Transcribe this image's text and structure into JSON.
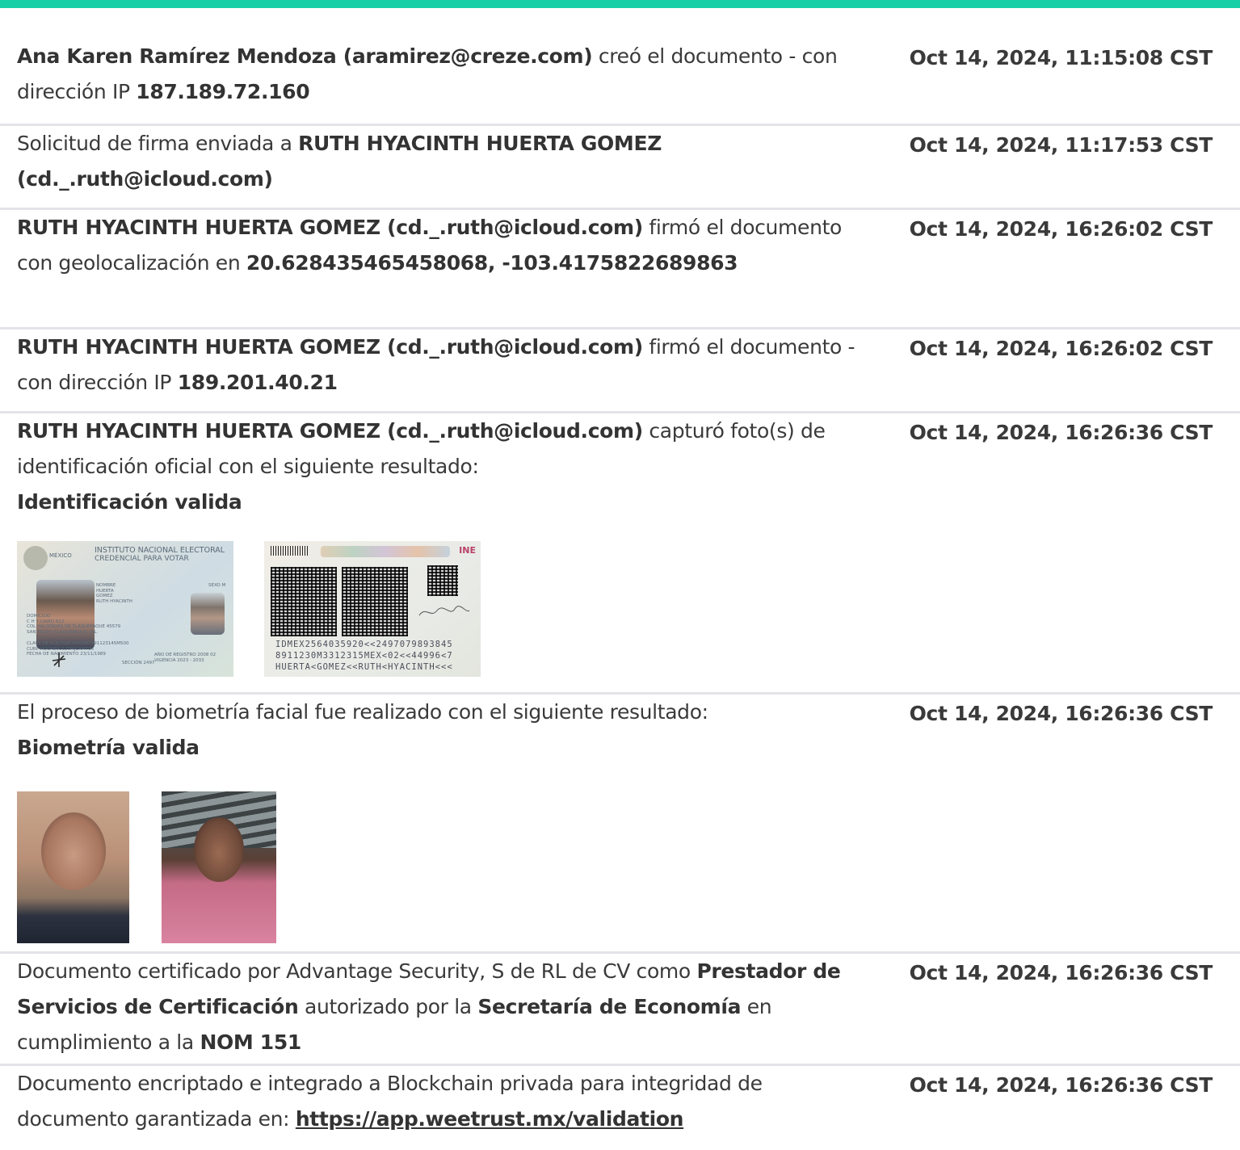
{
  "colors": {
    "accent_bar": "#16cfa6",
    "text": "#3a3a3a",
    "divider": "#e3e3e9"
  },
  "events": [
    {
      "parts": [
        {
          "t": "Ana Karen Ramírez Mendoza (aramirez@creze.com)",
          "b": true
        },
        {
          "t": " creó el documento - con dirección IP ",
          "b": false
        },
        {
          "t": "187.189.72.160",
          "b": true
        }
      ],
      "timestamp": "Oct 14, 2024, 11:15:08 CST"
    },
    {
      "parts": [
        {
          "t": "Solicitud de firma enviada a ",
          "b": false
        },
        {
          "t": "RUTH HYACINTH HUERTA GOMEZ (cd._.ruth@icloud.com)",
          "b": true
        }
      ],
      "timestamp": "Oct 14, 2024, 11:17:53 CST"
    },
    {
      "parts": [
        {
          "t": "RUTH HYACINTH HUERTA GOMEZ (cd._.ruth@icloud.com)",
          "b": true
        },
        {
          "t": " firmó el documento con geolocalización en ",
          "b": false
        },
        {
          "t": "20.628435465458068, -103.4175822689863",
          "b": true
        }
      ],
      "timestamp": "Oct 14, 2024, 16:26:02 CST"
    },
    {
      "parts": [
        {
          "t": "RUTH HYACINTH HUERTA GOMEZ (cd._.ruth@icloud.com)",
          "b": true
        },
        {
          "t": " firmó el documento - con dirección IP ",
          "b": false
        },
        {
          "t": "189.201.40.21",
          "b": true
        }
      ],
      "timestamp": "Oct 14, 2024, 16:26:02 CST"
    },
    {
      "parts": [
        {
          "t": "RUTH HYACINTH HUERTA GOMEZ (cd._.ruth@icloud.com)",
          "b": true
        },
        {
          "t": " capturó foto(s) de identificación oficial con el siguiente resultado:",
          "b": false
        }
      ],
      "result": "Identificación valida",
      "timestamp": "Oct 14, 2024, 16:26:36 CST",
      "id_front": {
        "country": "MÉXICO",
        "institute": "INSTITUTO NACIONAL ELECTORAL",
        "card_type": "CREDENCIAL PARA VOTAR",
        "name_label": "NOMBRE",
        "name_lines": [
          "HUERTA",
          "GOMEZ",
          "RUTH HYACINTH"
        ],
        "sex": "SEXO M",
        "address_label": "DOMICILIO",
        "address_lines": [
          "C H Y CAIRO 612",
          "COL HACIENDAS DE TLAQUEPAQUE 45579",
          "SAN PEDRO TLAQUEPAQUE, JAL."
        ],
        "elector_key": "CLAVE DE ELECTOR  HRGMRT891123145M500",
        "curp": "CURP  HUGR891123MJCRMT03",
        "birth": "FECHA DE NACIMIENTO  23/11/1989",
        "section": "SECCIÓN 2497",
        "registration": "AÑO DE REGISTRO 2008 02",
        "validity": "VIGENCIA 2023 - 2033"
      },
      "id_back": {
        "brand": "INE",
        "mrz": [
          "IDMEX2564035920<<2497079893845",
          "8911230M3312315MEX<02<<44996<7",
          "HUERTA<GOMEZ<<RUTH<HYACINTH<<<"
        ]
      }
    },
    {
      "parts": [
        {
          "t": "El proceso de biometría facial fue realizado con el siguiente resultado:",
          "b": false
        }
      ],
      "result": "Biometría valida",
      "timestamp": "Oct 14, 2024, 16:26:36 CST"
    },
    {
      "parts": [
        {
          "t": "Documento certificado por Advantage Security, S de RL de CV como ",
          "b": false
        },
        {
          "t": "Prestador de Servicios de Certificación",
          "b": true
        },
        {
          "t": " autorizado por la ",
          "b": false
        },
        {
          "t": "Secretaría de Economía",
          "b": true
        },
        {
          "t": " en cumplimiento a la ",
          "b": false
        },
        {
          "t": "NOM 151",
          "b": true
        }
      ],
      "timestamp": "Oct 14, 2024, 16:26:36 CST"
    },
    {
      "parts": [
        {
          "t": "Documento encriptado e integrado a Blockchain privada para integridad de documento garantizada en: ",
          "b": false
        },
        {
          "t": "https://app.weetrust.mx/validation",
          "b": true,
          "link": true
        }
      ],
      "timestamp": "Oct 14, 2024, 16:26:36 CST"
    }
  ]
}
